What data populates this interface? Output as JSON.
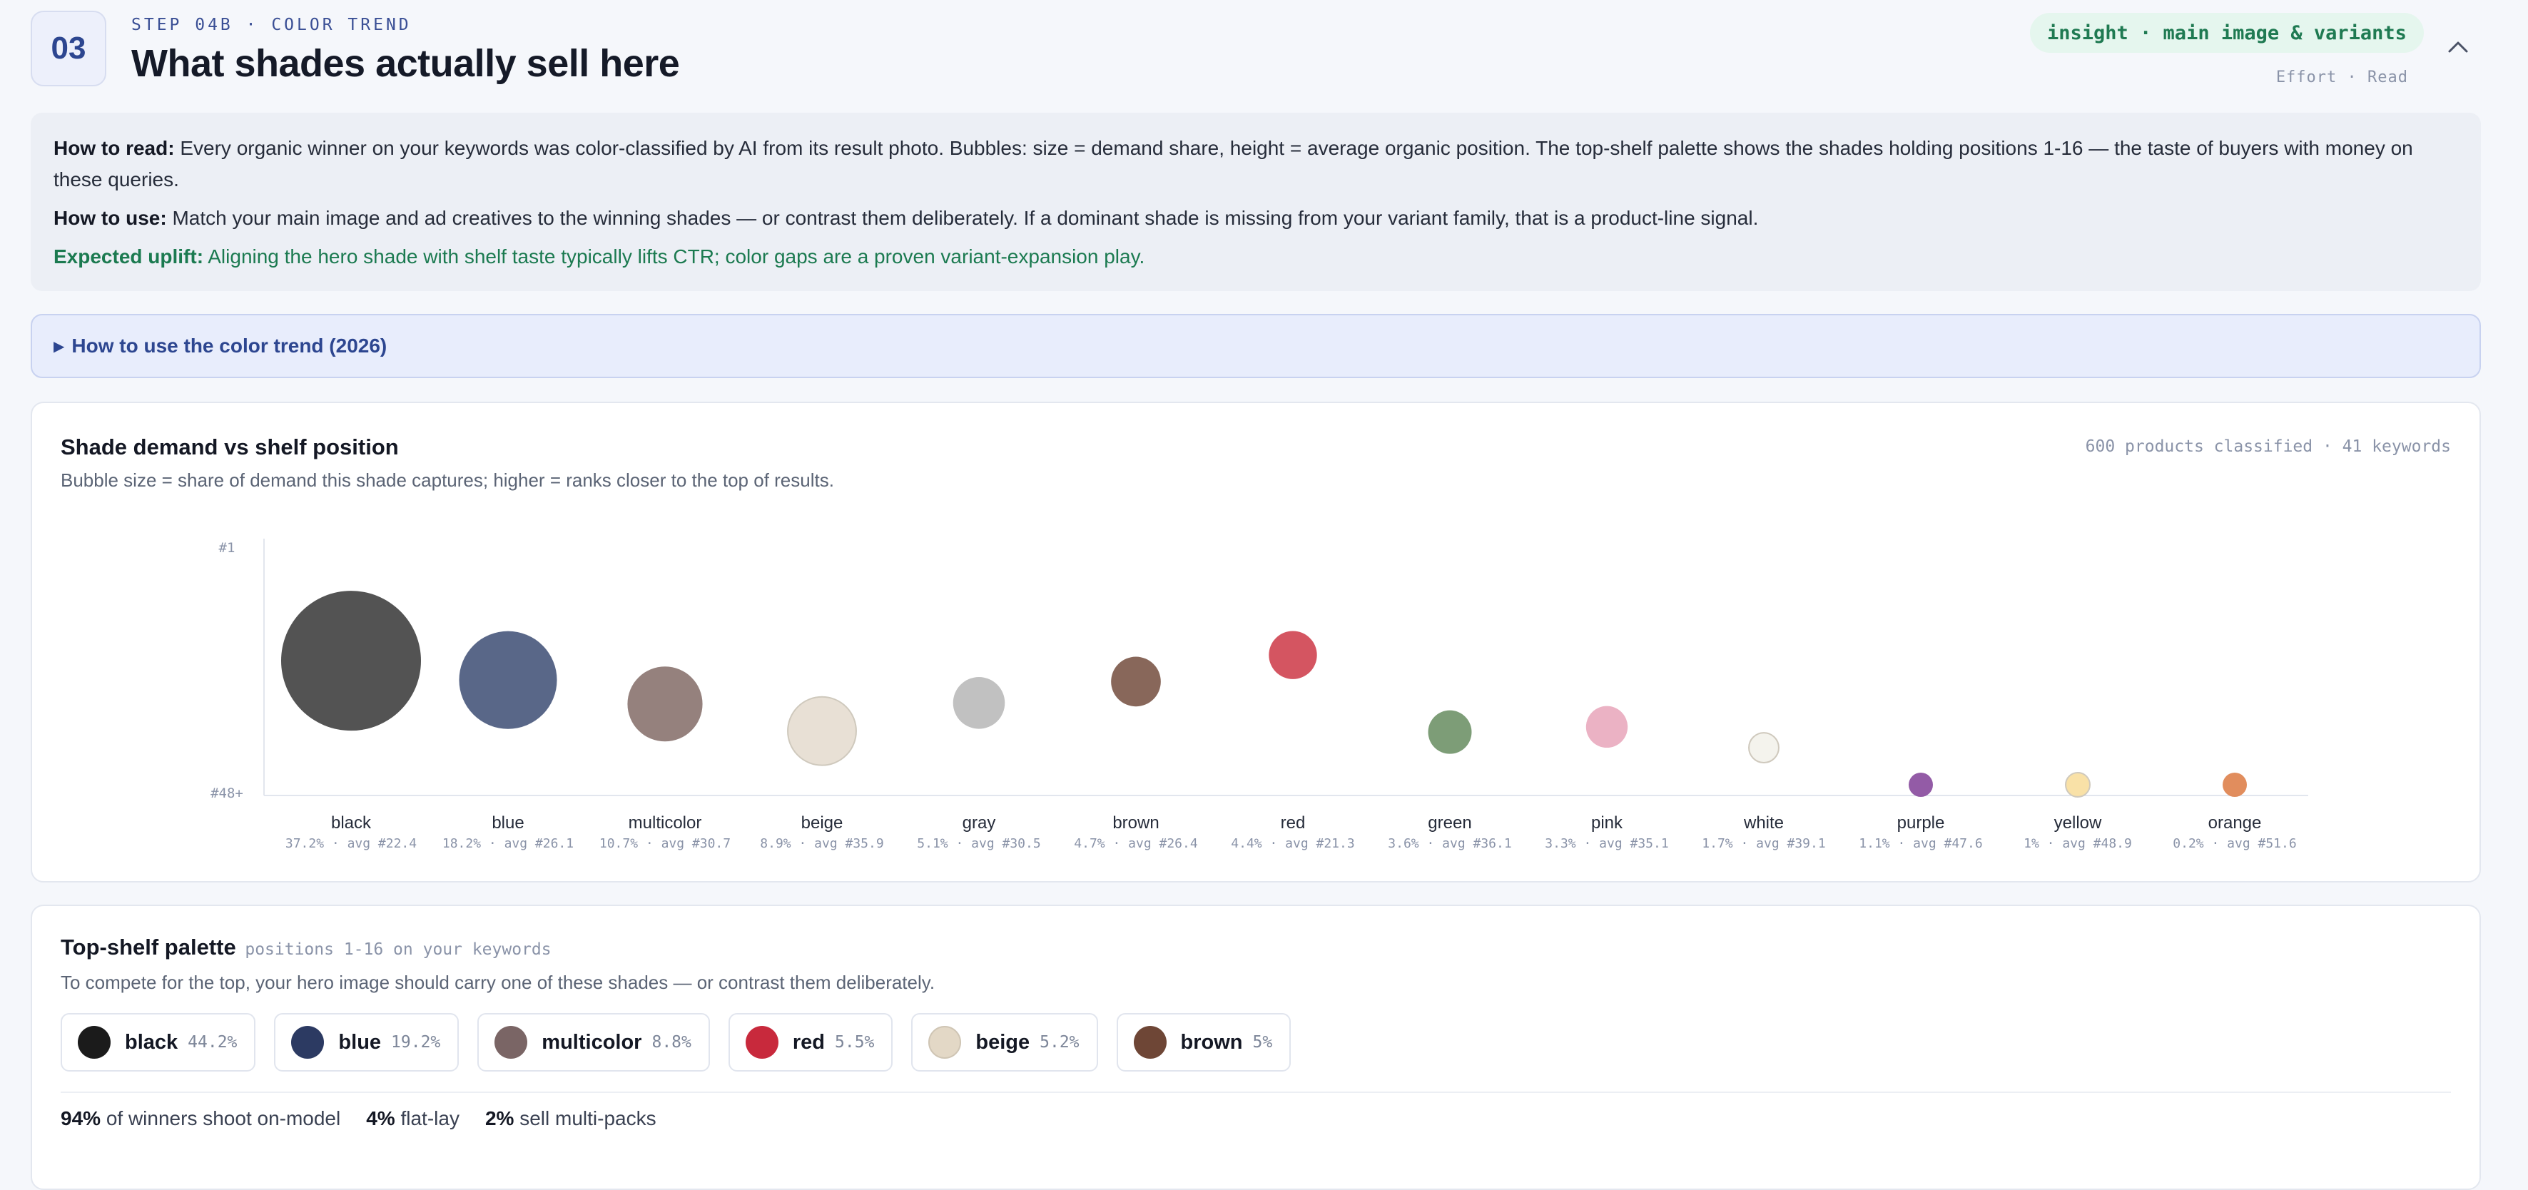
{
  "header": {
    "step_number": "03",
    "step_label": "STEP 04B · COLOR TREND",
    "title": "What shades actually sell here",
    "badge": "insight · main image & variants",
    "effort": "Effort · Read"
  },
  "info": {
    "read_label": "How to read:",
    "read_text": "Every organic winner on your keywords was color-classified by AI from its result photo. Bubbles: size = demand share, height = average organic position. The top-shelf palette shows the shades holding positions 1-16 — the taste of buyers with money on these queries.",
    "use_label": "How to use:",
    "use_text": "Match your main image and ad creatives to the winning shades — or contrast them deliberately. If a dominant shade is missing from your variant family, that is a product-line signal.",
    "uplift_label": "Expected uplift:",
    "uplift_text": "Aligning the hero shade with shelf taste typically lifts CTR; color gaps are a proven variant-expansion play."
  },
  "howto": {
    "label": "How to use the color trend (2026)"
  },
  "chart_card": {
    "title": "Shade demand vs shelf position",
    "subtitle": "Bubble size = share of demand this shade captures; higher = ranks closer to the top of results.",
    "meta": "600 products classified · 41 keywords"
  },
  "chart_data": {
    "type": "scatter",
    "title": "Shade demand vs shelf position",
    "y_axis_labels": [
      "#1",
      "#48+"
    ],
    "ylim": [
      1,
      48
    ],
    "y_inverted": true,
    "grid": false,
    "legend": "none",
    "points": [
      {
        "label": "black",
        "share": 37.2,
        "avg": 22.4,
        "detail": "37.2% · avg #22.4",
        "color": "#444444"
      },
      {
        "label": "blue",
        "share": 18.2,
        "avg": 26.1,
        "detail": "18.2% · avg #26.1",
        "color": "#4b5a7e"
      },
      {
        "label": "multicolor",
        "share": 10.7,
        "avg": 30.7,
        "detail": "10.7% · avg #30.7",
        "color": "#8c7672"
      },
      {
        "label": "beige",
        "share": 8.9,
        "avg": 35.9,
        "detail": "8.9% · avg #35.9",
        "color": "#e6ddd1"
      },
      {
        "label": "gray",
        "share": 5.1,
        "avg": 30.5,
        "detail": "5.1% · avg #30.5",
        "color": "#bcbcbc"
      },
      {
        "label": "brown",
        "share": 4.7,
        "avg": 26.4,
        "detail": "4.7% · avg #26.4",
        "color": "#7e5a4c"
      },
      {
        "label": "red",
        "share": 4.4,
        "avg": 21.3,
        "detail": "4.4% · avg #21.3",
        "color": "#d04654"
      },
      {
        "label": "green",
        "share": 3.6,
        "avg": 36.1,
        "detail": "3.6% · avg #36.1",
        "color": "#72956b"
      },
      {
        "label": "pink",
        "share": 3.3,
        "avg": 35.1,
        "detail": "3.3% · avg #35.1",
        "color": "#e9abbf"
      },
      {
        "label": "white",
        "share": 1.7,
        "avg": 39.1,
        "detail": "1.7% · avg #39.1",
        "color": "#f3f2ec"
      },
      {
        "label": "purple",
        "share": 1.1,
        "avg": 47.6,
        "detail": "1.1% · avg #47.6",
        "color": "#8a4d9e"
      },
      {
        "label": "yellow",
        "share": 1,
        "avg": 48.9,
        "detail": "1% · avg #48.9",
        "color": "#f8dea0"
      },
      {
        "label": "orange",
        "share": 0.2,
        "avg": 51.6,
        "detail": "0.2% · avg #51.6",
        "color": "#de834f"
      }
    ]
  },
  "palette": {
    "title": "Top-shelf palette",
    "title_note": "positions 1-16 on your keywords",
    "subtitle": "To compete for the top, your hero image should carry one of these shades — or contrast them deliberately.",
    "chips": [
      {
        "name": "black",
        "pct": "44.2%",
        "color": "#1b1b1b"
      },
      {
        "name": "blue",
        "pct": "19.2%",
        "color": "#2c3a62"
      },
      {
        "name": "multicolor",
        "pct": "8.8%",
        "color": "#7a6565"
      },
      {
        "name": "red",
        "pct": "5.5%",
        "color": "#c8293c"
      },
      {
        "name": "beige",
        "pct": "5.2%",
        "color": "#e3d8c6"
      },
      {
        "name": "brown",
        "pct": "5%",
        "color": "#6e4636"
      }
    ],
    "stats": [
      {
        "value": "94%",
        "label": "of winners shoot on-model"
      },
      {
        "value": "4%",
        "label": "flat-lay"
      },
      {
        "value": "2%",
        "label": "sell multi-packs"
      }
    ]
  }
}
